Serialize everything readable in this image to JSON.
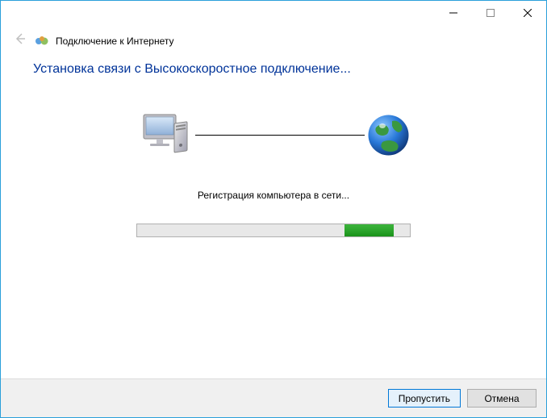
{
  "header": {
    "window_title": "Подключение к Интернету"
  },
  "main": {
    "heading": "Установка связи с Высокоскоростное подключение...",
    "status_text": "Регистрация компьютера в сети...",
    "progress_percent": 76,
    "progress_chunk_width": 18
  },
  "footer": {
    "skip_label": "Пропустить",
    "cancel_label": "Отмена"
  },
  "icons": {
    "back": "back-arrow-icon",
    "network": "network-center-icon",
    "computer": "computer-icon",
    "globe": "globe-icon",
    "minimize": "minimize-icon",
    "maximize": "maximize-icon",
    "close": "close-icon"
  }
}
